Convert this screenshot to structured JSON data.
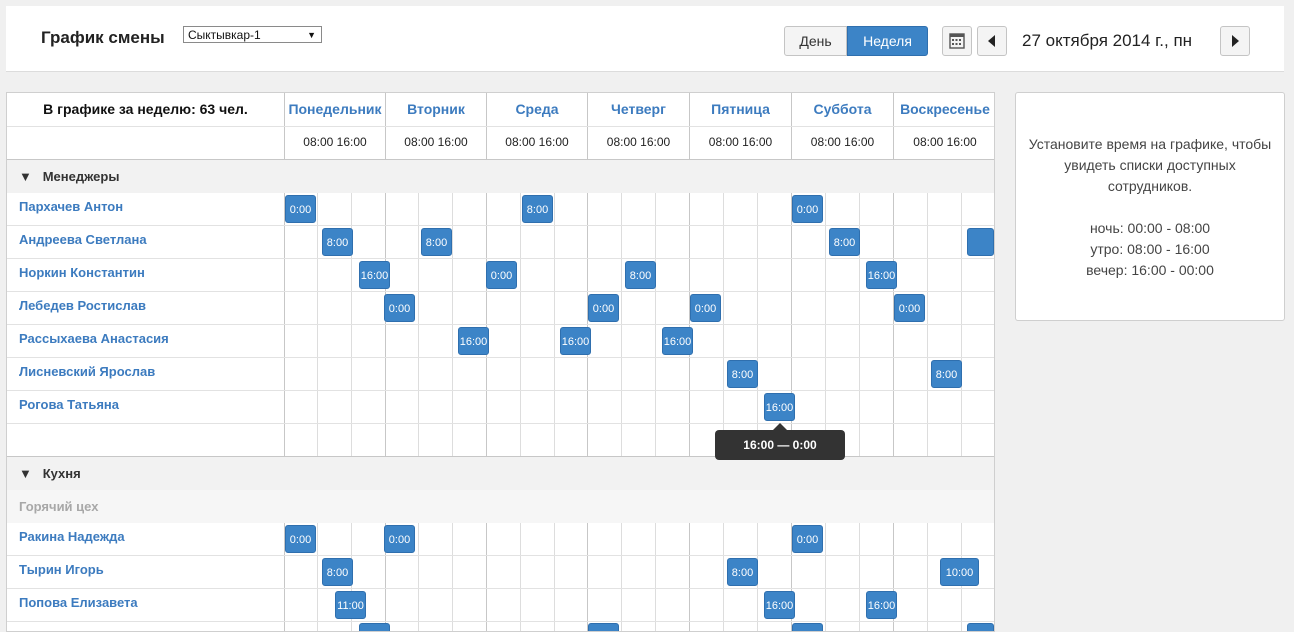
{
  "header": {
    "title": "График смены",
    "branch_select": "Сыктывкар-1",
    "view_day": "День",
    "view_week": "Неделя",
    "current_date": "27 октября 2014 г., пн",
    "icons": [
      "calendar-icon",
      "chevron-left-icon",
      "chevron-right-icon",
      "caret-down-icon"
    ]
  },
  "schedule": {
    "week_total": "В графике за неделю: 63 чел.",
    "days": [
      "Понедельник",
      "Вторник",
      "Среда",
      "Четверг",
      "Пятница",
      "Суббота",
      "Воскресенье"
    ],
    "time_label": "08:00 16:00",
    "groups": [
      {
        "name": "Менеджеры",
        "toggle": "▼",
        "employees": [
          {
            "name": "Пархачев Антон",
            "shifts": [
              "0:00",
              "8:00",
              "0:00"
            ]
          },
          {
            "name": "Андреева Светлана",
            "shifts": [
              "8:00",
              "8:00",
              "8:00",
              ""
            ]
          },
          {
            "name": "Норкин Константин",
            "shifts": [
              "16:00",
              "0:00",
              "8:00",
              "16:00"
            ]
          },
          {
            "name": "Лебедев Ростислав",
            "shifts": [
              "0:00",
              "0:00",
              "0:00",
              "0:00"
            ]
          },
          {
            "name": "Рассыхаева Анастасия",
            "shifts": [
              "16:00",
              "16:00",
              "16:00"
            ]
          },
          {
            "name": "Лисневский Ярослав",
            "shifts": [
              "8:00",
              "8:00"
            ]
          },
          {
            "name": "Рогова Татьяна",
            "shifts": [
              "16:00"
            ]
          }
        ]
      },
      {
        "name": "Кухня",
        "toggle": "▼",
        "subgroup": "Горячий цех",
        "employees": [
          {
            "name": "Ракина Надежда",
            "shifts": [
              "0:00",
              "0:00",
              "0:00"
            ]
          },
          {
            "name": "Тырин Игорь",
            "shifts": [
              "8:00",
              "8:00",
              "10:00"
            ]
          },
          {
            "name": "Попова Елизавета",
            "shifts": [
              "11:00",
              "16:00",
              "16:00"
            ]
          }
        ]
      }
    ],
    "tooltip": "16:00 — 0:00"
  },
  "info_panel": {
    "lines": [
      "Установите время на графике, чтобы",
      "увидеть списки доступных",
      "сотрудников.",
      "",
      "ночь: 00:00 - 08:00",
      "утро: 08:00 - 16:00",
      "вечер: 16:00 - 00:00"
    ]
  }
}
